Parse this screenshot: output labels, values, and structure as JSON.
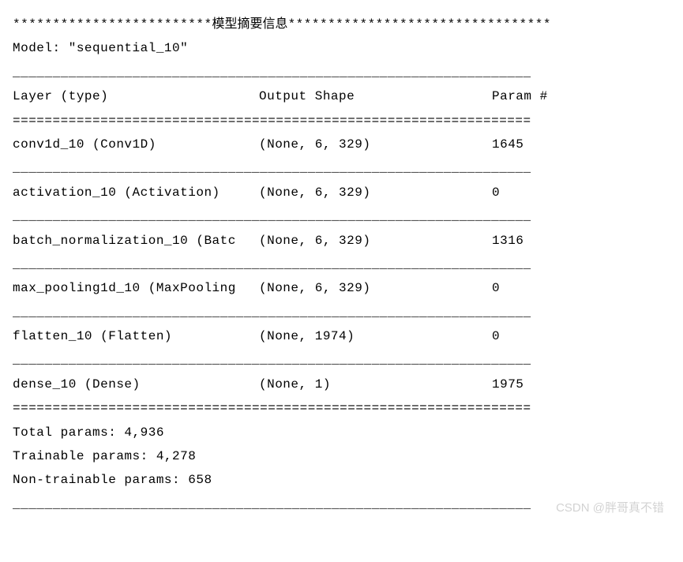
{
  "title": {
    "stars_left": "*************************",
    "text": "模型摘要信息",
    "stars_right": "*********************************"
  },
  "model_line": "Model: \"sequential_10\"",
  "header": {
    "layer": "Layer (type)",
    "output": "Output Shape",
    "param": "Param #"
  },
  "sep_underscore": "_________________________________________________________________",
  "sep_dash": "_________________________________________________________________",
  "sep_equal": "=================================================================",
  "layers": [
    {
      "layer": "conv1d_10 (Conv1D)",
      "output": "(None, 6, 329)",
      "param": "1645"
    },
    {
      "layer": "activation_10 (Activation)",
      "output": "(None, 6, 329)",
      "param": "0"
    },
    {
      "layer": "batch_normalization_10 (Batc",
      "output": "(None, 6, 329)",
      "param": "1316"
    },
    {
      "layer": "max_pooling1d_10 (MaxPooling",
      "output": "(None, 6, 329)",
      "param": "0"
    },
    {
      "layer": "flatten_10 (Flatten)",
      "output": "(None, 1974)",
      "param": "0"
    },
    {
      "layer": "dense_10 (Dense)",
      "output": "(None, 1)",
      "param": "1975"
    }
  ],
  "totals": {
    "total": "Total params: 4,936",
    "trainable": "Trainable params: 4,278",
    "nontrainable": "Non-trainable params: 658"
  },
  "watermark": "CSDN @胖哥真不错"
}
